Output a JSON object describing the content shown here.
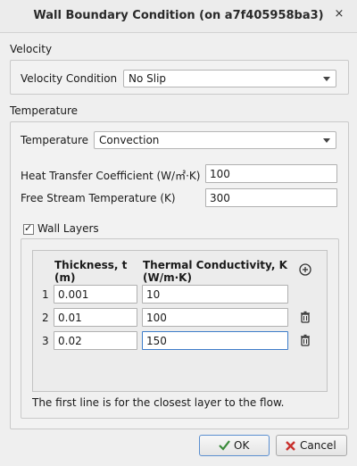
{
  "window": {
    "title": "Wall Boundary Condition (on a7f405958ba3)",
    "close_glyph": "×"
  },
  "velocity": {
    "section_label": "Velocity",
    "condition_label": "Velocity Condition",
    "condition_value": "No Slip"
  },
  "temperature": {
    "section_label": "Temperature",
    "type_label": "Temperature",
    "type_value": "Convection",
    "htc_label": "Heat Transfer Coefficient (W/㎡·K)",
    "htc_value": "100",
    "fst_label": "Free Stream Temperature (K)",
    "fst_value": "300"
  },
  "wall_layers": {
    "checkbox_label": "Wall Layers",
    "checked": true,
    "check_glyph": "✓",
    "col_thickness_line1": "Thickness, t",
    "col_thickness_line2": "(m)",
    "col_conductivity_line1": "Thermal Conductivity, K",
    "col_conductivity_line2": "(W/m·K)",
    "rows": [
      {
        "index": "1",
        "thickness": "0.001",
        "conductivity": "10"
      },
      {
        "index": "2",
        "thickness": "0.01",
        "conductivity": "100"
      },
      {
        "index": "3",
        "thickness": "0.02",
        "conductivity": "150"
      }
    ],
    "footnote": "The first line is for the closest layer to the flow."
  },
  "buttons": {
    "ok_label": "OK",
    "cancel_label": "Cancel"
  },
  "icons": {
    "add": "add-circle-icon",
    "delete": "trash-icon",
    "ok": "checkmark-icon",
    "cancel": "cancel-x-icon"
  },
  "colors": {
    "focus_border": "#3d7cc9",
    "cancel_red": "#c8302c",
    "ok_green": "#3a8a3a"
  }
}
